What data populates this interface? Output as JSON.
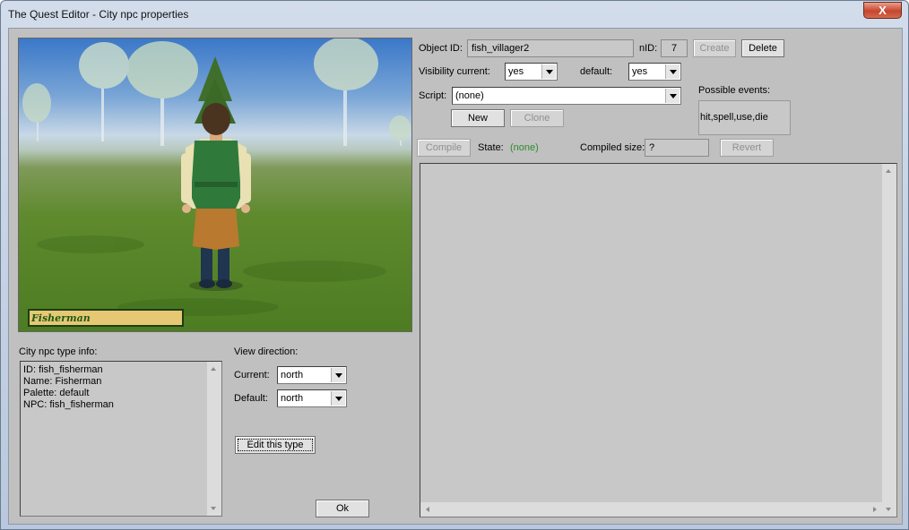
{
  "window": {
    "title": "The Quest Editor - City npc properties",
    "close_label": "X"
  },
  "preview": {
    "npc_name": "Fisherman"
  },
  "object": {
    "id_label": "Object ID:",
    "id_value": "fish_villager2",
    "nid_label": "nID:",
    "nid_value": "7",
    "create_label": "Create",
    "delete_label": "Delete"
  },
  "visibility": {
    "current_label": "Visibility current:",
    "current_value": "yes",
    "default_label": "default:",
    "default_value": "yes"
  },
  "script": {
    "label": "Script:",
    "value": "(none)",
    "new_label": "New",
    "clone_label": "Clone",
    "compile_label": "Compile",
    "state_label": "State:",
    "state_value": "(none)",
    "state_color": "#2e8b2e",
    "compiled_size_label": "Compiled size:",
    "compiled_size_value": "?",
    "revert_label": "Revert"
  },
  "events": {
    "label": "Possible events:",
    "value": "hit,spell,use,die"
  },
  "type_info": {
    "label": "City npc type info:",
    "lines": [
      "ID: fish_fisherman",
      "Name: Fisherman",
      "Palette: default",
      "NPC: fish_fisherman"
    ]
  },
  "view_direction": {
    "label": "View direction:",
    "current_label": "Current:",
    "current_value": "north",
    "default_label": "Default:",
    "default_value": "north"
  },
  "buttons": {
    "edit_type_label": "Edit this type",
    "ok_label": "Ok"
  }
}
